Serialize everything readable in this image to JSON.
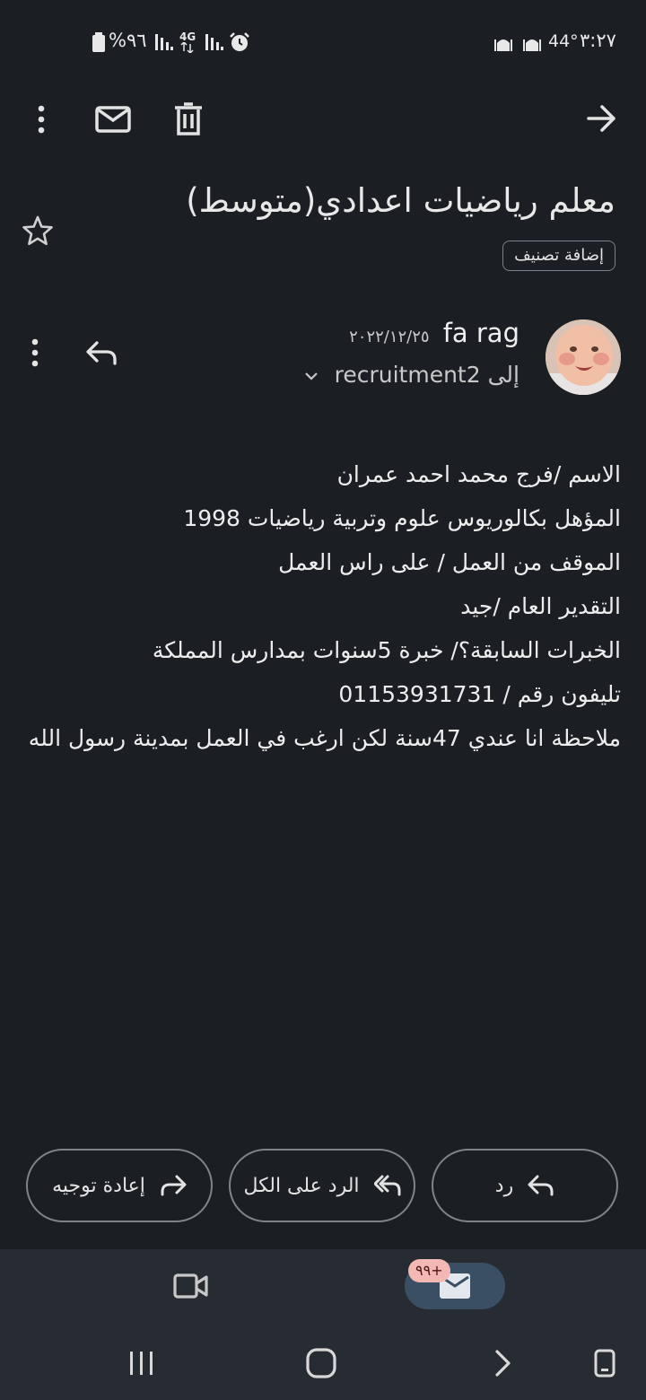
{
  "status_bar": {
    "battery": "%٩٦",
    "network": "4G",
    "temperature": "44°",
    "time": "٣:٢٧"
  },
  "toolbar": {
    "back_icon": "arrow-right-icon",
    "delete_icon": "trash-icon",
    "unread_icon": "mail-icon",
    "more_icon": "more-vert-icon"
  },
  "email": {
    "subject": "معلم رياضيات  اعدادي(متوسط)",
    "add_label_chip": "إضافة تصنيف",
    "sender_name": "fa rag",
    "date": "٢٠٢٢/١٢/٢٥",
    "recipient_prefix": "إلى",
    "recipient": "recruitment2",
    "body_lines": [
      "الاسم /فرج محمد احمد عمران",
      "المؤهل بكالوريوس علوم وتربية رياضيات 1998",
      "الموقف من العمل / على راس العمل",
      "التقدير العام /جيد",
      "الخبرات السابقة؟/ خبرة 5سنوات بمدارس المملكة",
      "تليفون رقم / 01153931731",
      "ملاحظة انا عندي 47سنة لكن ارغب في العمل بمدينة رسول الله"
    ]
  },
  "actions": {
    "reply": "رد",
    "reply_all": "الرد على الكل",
    "forward": "إعادة توجيه"
  },
  "bottom_nav": {
    "mail_badge": "٩٩+",
    "mail_icon": "mail-icon",
    "meet_icon": "video-camera-icon"
  },
  "colors": {
    "background": "#1b1f23",
    "nav_background": "#272c32",
    "active_pill": "#3a4f63",
    "badge": "#f3b8b3"
  }
}
